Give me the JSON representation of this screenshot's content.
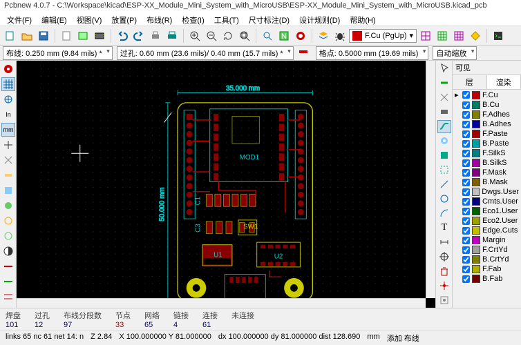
{
  "title": "Pcbnew 4.0.7 - C:\\Workspace\\kicad\\ESP-XX_Module_Mini_System_with_MicroUSB\\ESP-XX_Module_Mini_System_with_MicroUSB.kicad_pcb",
  "menu": [
    "文件(F)",
    "编辑(E)",
    "视图(V)",
    "放置(P)",
    "布线(R)",
    "检查(I)",
    "工具(T)",
    "尺寸标注(D)",
    "设计规则(D)",
    "帮助(H)"
  ],
  "layer_combo": "F.Cu (PgUp)",
  "status2": {
    "trace": "布线: 0.250 mm (9.84 mils) *",
    "via": "过孔: 0.60 mm (23.6 mils)/ 0.40 mm (15.7 mils) *",
    "grid": "格点: 0.5000 mm (19.69 mils)",
    "zoom": "自动缩放"
  },
  "panel": {
    "header": "可见",
    "tabs": [
      "层",
      "渲染"
    ],
    "layers": [
      {
        "name": "F.Cu",
        "color": "#c00000",
        "sel": true
      },
      {
        "name": "B.Cu",
        "color": "#008060",
        "sel": false
      },
      {
        "name": "F.Adhes",
        "color": "#808000",
        "sel": false
      },
      {
        "name": "B.Adhes",
        "color": "#0000a0",
        "sel": false
      },
      {
        "name": "F.Paste",
        "color": "#a00000",
        "sel": false
      },
      {
        "name": "B.Paste",
        "color": "#00a0a0",
        "sel": false
      },
      {
        "name": "F.SilkS",
        "color": "#008080",
        "sel": false
      },
      {
        "name": "B.SilkS",
        "color": "#a000a0",
        "sel": false
      },
      {
        "name": "F.Mask",
        "color": "#800080",
        "sel": false
      },
      {
        "name": "B.Mask",
        "color": "#806000",
        "sel": false
      },
      {
        "name": "Dwgs.User",
        "color": "#c0c0c0",
        "sel": false
      },
      {
        "name": "Cmts.User",
        "color": "#000080",
        "sel": false
      },
      {
        "name": "Eco1.User",
        "color": "#006000",
        "sel": false
      },
      {
        "name": "Eco2.User",
        "color": "#a0a000",
        "sel": false
      },
      {
        "name": "Edge.Cuts",
        "color": "#c0c000",
        "sel": false
      },
      {
        "name": "Margin",
        "color": "#c000c0",
        "sel": false
      },
      {
        "name": "F.CrtYd",
        "color": "#a0a0a0",
        "sel": false
      },
      {
        "name": "B.CrtYd",
        "color": "#808000",
        "sel": false
      },
      {
        "name": "F.Fab",
        "color": "#b0b000",
        "sel": false
      },
      {
        "name": "B.Fab",
        "color": "#700000",
        "sel": false
      }
    ]
  },
  "footer": {
    "cols": [
      {
        "lbl": "焊盘",
        "val": "101",
        "red": false
      },
      {
        "lbl": "过孔",
        "val": "12",
        "red": false
      },
      {
        "lbl": "布线分段数",
        "val": "97",
        "red": false
      },
      {
        "lbl": "节点",
        "val": "33",
        "red": true
      },
      {
        "lbl": "网络",
        "val": "65",
        "red": false
      },
      {
        "lbl": "链接",
        "val": "4",
        "red": false
      },
      {
        "lbl": "连接",
        "val": "61",
        "red": false
      },
      {
        "lbl": "未连接",
        "val": "",
        "red": false
      }
    ],
    "row2": {
      "links": "links 65  nc 61  net 14: n",
      "z": "Z 2.84",
      "xy": "X 100.000000  Y 81.000000",
      "dxy": "dx 100.000000  dy 81.000000  dist 128.690",
      "unit": "mm",
      "add": "添加 布线"
    }
  },
  "board": {
    "dim_top": "35.000 mm",
    "dim_left": "50.000 mm",
    "ref": "MOD1",
    "c1": "C1",
    "c3": "C3",
    "u1": "U1",
    "u2": "U2",
    "sw1": "SW1"
  },
  "chart_data": {
    "type": "table",
    "title": "PCB statistics",
    "categories": [
      "焊盘",
      "过孔",
      "布线分段数",
      "节点",
      "网络",
      "链接",
      "连接"
    ],
    "values": [
      101,
      12,
      97,
      33,
      65,
      4,
      61
    ]
  }
}
